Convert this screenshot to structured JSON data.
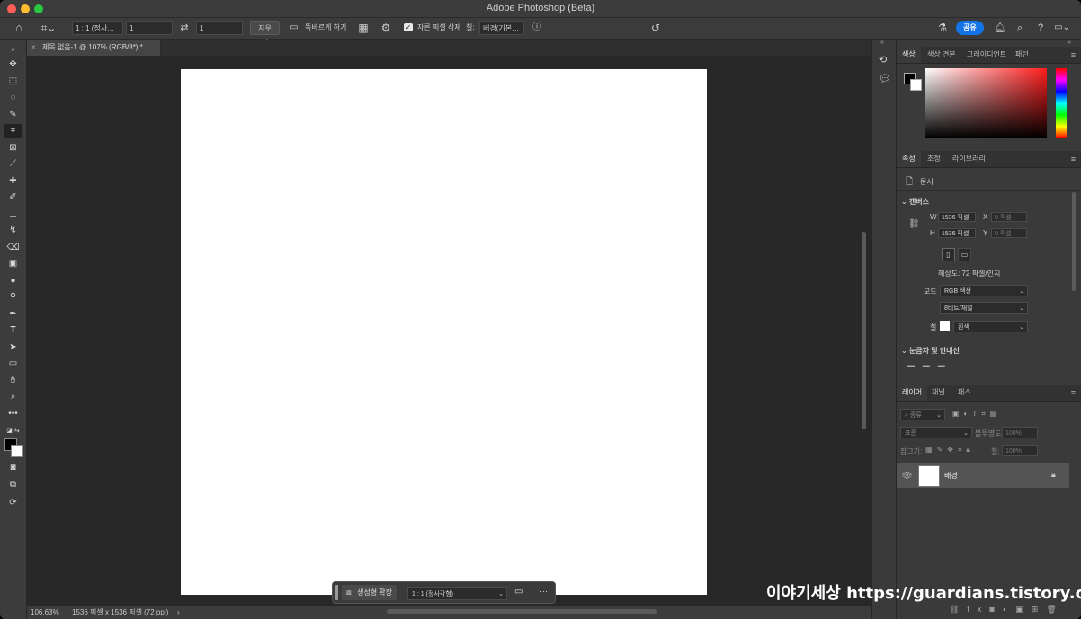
{
  "window": {
    "title": "Adobe Photoshop (Beta)"
  },
  "options_bar": {
    "ratio_select": "1 : 1 (정사…",
    "width_value": "1",
    "height_value": "1",
    "clear_label": "지우기",
    "straighten_label": "똑바르게 하기",
    "delete_cropped_label": "자른 픽셀 삭제",
    "delete_cropped_checked": true,
    "fill_label": "칠:",
    "fill_select": "배경(기본…",
    "share_label": "공유"
  },
  "document_tab": {
    "label": "제목 없음-1 @ 107% (RGB/8*) *",
    "close": "×"
  },
  "status_bar": {
    "zoom": "106.63%",
    "doc_info": "1536 픽셀 x 1536 픽셀 (72 ppi)",
    "arrow": "›"
  },
  "context_taskbar": {
    "generative_expand_label": "생성형 확장",
    "ratio_select": "1 : 1 (정사각형)",
    "more": "···"
  },
  "color_panel": {
    "tabs": [
      "색상",
      "색상 견본",
      "그레이디언트",
      "패턴"
    ],
    "selected_tab": 0,
    "foreground": "#000000",
    "background": "#ffffff"
  },
  "properties_panel": {
    "tabs": [
      "속성",
      "조정",
      "라이브러리"
    ],
    "selected_tab": 0,
    "doc_label": "문서",
    "canvas_section": "캔버스",
    "w_label": "W",
    "w_value": "1536 픽셀",
    "h_label": "H",
    "h_value": "1536 픽셀",
    "x_label": "X",
    "x_placeholder": "0 픽셀",
    "y_label": "Y",
    "y_placeholder": "0 픽셀",
    "resolution": "해상도: 72 픽셀/인치",
    "mode_label": "모드",
    "mode_value": "RGB 색상",
    "depth_value": "8비트/채널",
    "fill_label": "칠",
    "fill_value": "흰색",
    "rulers_section": "눈금자 및 안내선"
  },
  "layers_panel": {
    "tabs": [
      "레이어",
      "채널",
      "패스"
    ],
    "selected_tab": 0,
    "filter_label": "종류",
    "blend_mode": "표준",
    "opacity_label": "불투명도:",
    "opacity_value": "100%",
    "lock_label": "잠그기:",
    "fill_label": "칠:",
    "fill_value": "100%",
    "layers": [
      {
        "name": "배경",
        "visible": true,
        "locked": true
      }
    ]
  },
  "watermark": "이야기세상 https://guardians.tistory.com",
  "accent_color": "#1473e6"
}
